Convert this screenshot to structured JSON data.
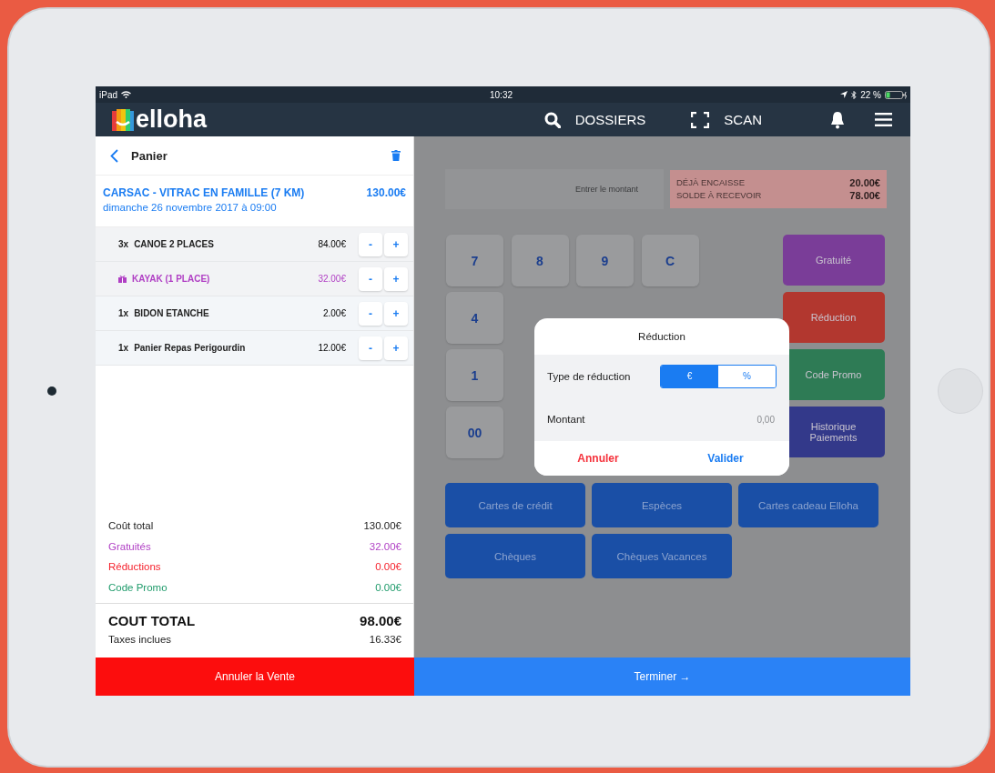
{
  "status_bar": {
    "device": "iPad",
    "time": "10:32",
    "battery": "22 %"
  },
  "nav": {
    "brand": "elloha",
    "items": [
      {
        "kind": "search",
        "label": "DOSSIERS"
      },
      {
        "kind": "scan",
        "label": "SCAN"
      },
      {
        "kind": "bell"
      },
      {
        "kind": "menu"
      }
    ]
  },
  "cart": {
    "title": "Panier",
    "event": {
      "title": "CARSAC - VITRAC EN FAMILLE (7 KM)",
      "price": "130.00€",
      "date": "dimanche 26 novembre 2017 à 09:00"
    },
    "items": [
      {
        "kind": "item",
        "quantity": "3x",
        "name": "CANOE 2 PLACES",
        "price": "84.00€",
        "minus": "-",
        "plus": "+"
      },
      {
        "kind": "gift",
        "name": "KAYAK (1 PLACE)",
        "price": "32.00€",
        "minus": "-",
        "plus": "+"
      },
      {
        "kind": "item",
        "quantity": "1x",
        "name": "BIDON ETANCHE",
        "price": "2.00€",
        "minus": "-",
        "plus": "+"
      },
      {
        "kind": "item",
        "quantity": "1x",
        "name": "Panier Repas Perigourdin",
        "price": "12.00€",
        "minus": "-",
        "plus": "+"
      }
    ],
    "summary": [
      {
        "label": "Coût total",
        "value": "130.00€",
        "color": "#222222"
      },
      {
        "label": "Gratuités",
        "value": "32.00€",
        "color": "#b03fc4"
      },
      {
        "label": "Réductions",
        "value": "0.00€",
        "color": "#f5222d"
      },
      {
        "label": "Code Promo",
        "value": "0.00€",
        "color": "#1f9b6b"
      }
    ],
    "total": {
      "label": "COUT TOTAL",
      "value": "98.00€"
    },
    "taxes": {
      "label": "Taxes inclues",
      "value": "16.33€"
    }
  },
  "payment": {
    "amount_field": {
      "placeholder": "Entrer le montant"
    },
    "balance": [
      {
        "label": "DÉJÀ ENCAISSE",
        "value": "20.00€"
      },
      {
        "label": "SOLDE À RECEVOIR",
        "value": "78.00€"
      }
    ],
    "keypad": [
      [
        "7",
        "8",
        "9",
        "C"
      ],
      [
        "4"
      ],
      [
        "1"
      ],
      [
        "00"
      ]
    ],
    "actions": [
      {
        "label": "Gratuité",
        "color": "#7a3d98"
      },
      {
        "label": "Réduction",
        "color": "#b2372f"
      },
      {
        "label": "Code Promo",
        "color": "#2e7b55"
      },
      {
        "label": "Historique Paiements",
        "color": "#33398a"
      }
    ],
    "methods": [
      "Cartes de crédit",
      "Espèces",
      "Cartes cadeau Elloha",
      "Chèques",
      "Chèques Vacances"
    ]
  },
  "dialog": {
    "title": "Réduction",
    "type_label": "Type de réduction",
    "segments": [
      {
        "label": "€",
        "selected": true
      },
      {
        "label": "%",
        "selected": false
      }
    ],
    "amount_label": "Montant",
    "amount_placeholder": "0,00",
    "cancel": "Annuler",
    "confirm": "Valider"
  },
  "footer": {
    "cancel": "Annuler la Vente",
    "finish": "Terminer →"
  }
}
